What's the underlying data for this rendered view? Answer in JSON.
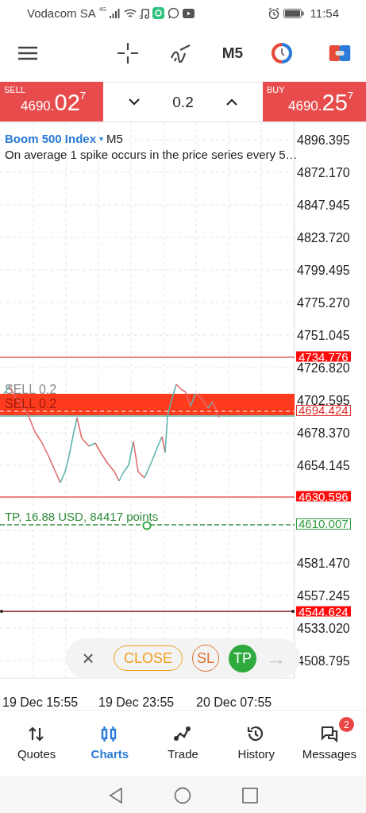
{
  "status_bar": {
    "carrier": "Vodacom SA",
    "network": "4G",
    "time": "11:54"
  },
  "toolbar": {
    "timeframe": "M5"
  },
  "trade_panel": {
    "sell": {
      "label": "SELL",
      "price_small": "4690.",
      "price_big": "02",
      "price_sup": "7"
    },
    "volume": "0.2",
    "buy": {
      "label": "BUY",
      "price_small": "4690.",
      "price_big": "25",
      "price_sup": "7"
    }
  },
  "chart": {
    "symbol": "Boom 500 Index",
    "symbol_menu": "▾",
    "timeframe": "M5",
    "description": "On average 1 spike occurs in the price series every 5…",
    "price_axis": [
      "4896.395",
      "4872.170",
      "4847.945",
      "4823.720",
      "4799.495",
      "4775.270",
      "4751.045",
      "4726.820",
      "4702.595",
      "4678.370",
      "4654.145",
      "4581.470",
      "4557.245",
      "4533.020",
      "4508.795"
    ],
    "time_axis": [
      "19 Dec 15:55",
      "19 Dec 23:55",
      "20 Dec 07:55"
    ],
    "levels": [
      {
        "kind": "stop",
        "price": "4734.776"
      },
      {
        "kind": "position",
        "price": "4694.424",
        "label": "SELL 0.2",
        "ghost_label": "SELL 0.2"
      },
      {
        "kind": "stop",
        "price": "4630.596"
      },
      {
        "kind": "takeprofit",
        "price": "4610.007",
        "label": "TP, 16.88 USD, 84417 points"
      },
      {
        "kind": "alert",
        "price": "4544.624"
      }
    ],
    "actions": [
      {
        "kind": "dismiss",
        "label": "×"
      },
      {
        "kind": "close",
        "label": "CLOSE"
      },
      {
        "kind": "sl",
        "label": "SL"
      },
      {
        "kind": "tp",
        "label": "TP"
      },
      {
        "kind": "next",
        "label": "→",
        "disabled": true
      }
    ]
  },
  "bottom_nav": [
    {
      "label": "Quotes",
      "selected": false
    },
    {
      "label": "Charts",
      "selected": true
    },
    {
      "label": "Trade",
      "selected": false
    },
    {
      "label": "History",
      "selected": false
    },
    {
      "label": "Messages",
      "selected": false,
      "badge": "2"
    }
  ]
}
